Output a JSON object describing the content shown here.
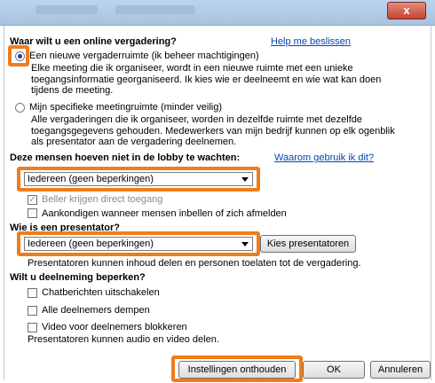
{
  "window": {
    "close_label": "x"
  },
  "meeting_type": {
    "question": "Waar wilt u een online vergadering?",
    "help_link": "Help me beslissen",
    "option_new": {
      "label": "Een nieuwe vergaderruimte (ik beheer machtigingen)",
      "description": "Elke meeting die ik organiseer, wordt in een nieuwe ruimte met een unieke toegangsinformatie georganiseerd. Ik kies wie er deelneemt en wie wat kan doen tijdens de meeting.",
      "selected": true
    },
    "option_space": {
      "label": "Mijn specifieke meetingruimte (minder veilig)",
      "description": "Alle vergaderingen die ik organiseer, worden in dezelfde ruimte met dezelfde toegangsgegevens gehouden. Medewerkers van mijn bedrijf kunnen op elk ogenblik als presentator aan de vergadering deelnemen.",
      "selected": false
    }
  },
  "lobby": {
    "heading": "Deze mensen hoeven niet in de lobby te wachten:",
    "why_link": "Waarom gebruik ik dit?",
    "selected": "Iedereen (geen beperkingen)",
    "callers_direct": "Beller krijgen direct toegang",
    "announce": "Aankondigen wanneer mensen inbellen of zich afmelden"
  },
  "presenter": {
    "heading": "Wie is een presentator?",
    "selected": "Iedereen (geen beperkingen)",
    "choose_button": "Kies presentatoren",
    "note": "Presentatoren kunnen inhoud delen en personen toelaten tot de vergadering."
  },
  "restrict": {
    "heading": "Wilt u deelneming beperken?",
    "disable_chat": "Chatberichten uitschakelen",
    "mute_all": "Alle deelnemers dempen",
    "block_video": "Video voor deelnemers blokkeren",
    "note": "Presentatoren kunnen audio en video delen."
  },
  "footer": {
    "remember": "Instellingen onthouden",
    "ok": "OK",
    "cancel": "Annuleren"
  },
  "colors": {
    "highlight": "#f07c1c",
    "link": "#0645ad"
  }
}
